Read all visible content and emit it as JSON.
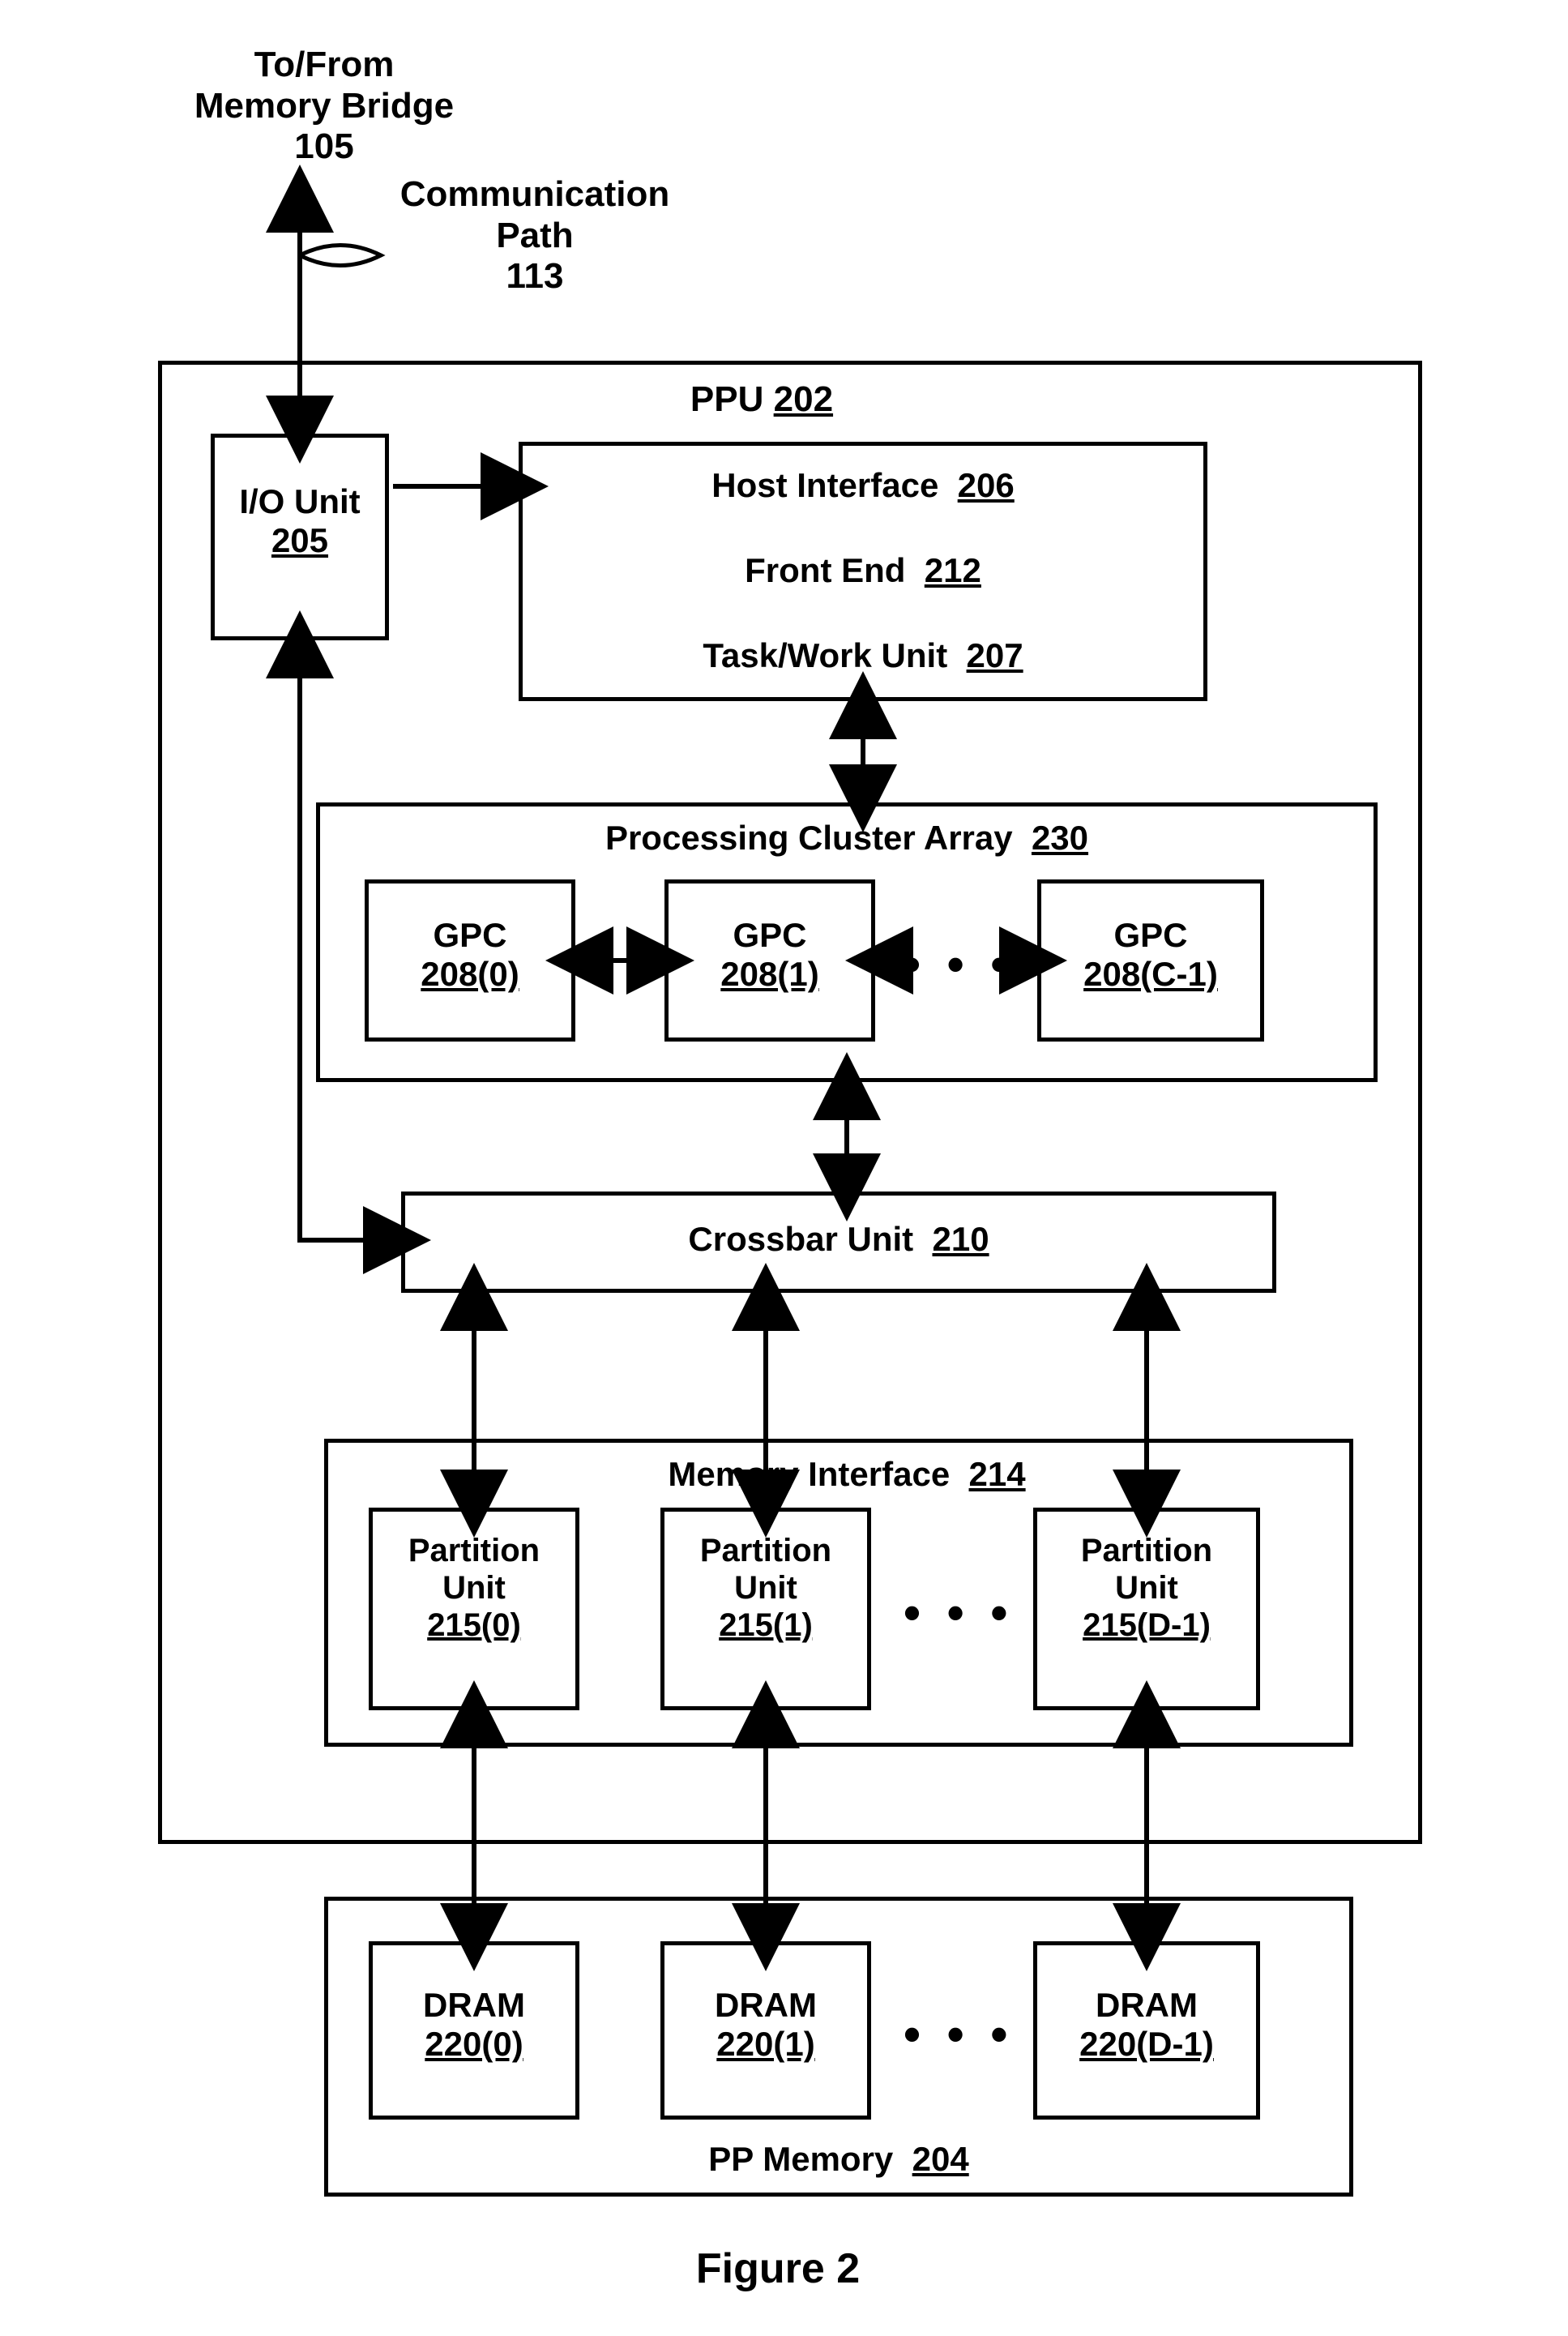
{
  "figure_caption": "Figure 2",
  "top_label": {
    "l1": "To/From",
    "l2": "Memory Bridge",
    "l3": "105"
  },
  "comm_path": {
    "l1": "Communication",
    "l2": "Path",
    "l3": "113"
  },
  "ppu": {
    "name": "PPU",
    "num": "202"
  },
  "io_unit": {
    "name": "I/O Unit",
    "num": "205"
  },
  "host_interface": {
    "name": "Host Interface",
    "num": "206"
  },
  "front_end": {
    "name": "Front End",
    "num": "212"
  },
  "task_work_unit": {
    "name": "Task/Work Unit",
    "num": "207"
  },
  "pca": {
    "name": "Processing Cluster Array",
    "num": "230"
  },
  "gpc0": {
    "name": "GPC",
    "num": "208(0)"
  },
  "gpc1": {
    "name": "GPC",
    "num": "208(1)"
  },
  "gpcN": {
    "name": "GPC",
    "num": "208(C-1)"
  },
  "crossbar": {
    "name": "Crossbar Unit",
    "num": "210"
  },
  "mem_if": {
    "name": "Memory Interface",
    "num": "214"
  },
  "pu0": {
    "name": "Partition",
    "name2": "Unit",
    "num": "215(0)"
  },
  "pu1": {
    "name": "Partition",
    "name2": "Unit",
    "num": "215(1)"
  },
  "puN": {
    "name": "Partition",
    "name2": "Unit",
    "num": "215(D-1)"
  },
  "dram0": {
    "name": "DRAM",
    "num": "220(0)"
  },
  "dram1": {
    "name": "DRAM",
    "num": "220(1)"
  },
  "dramN": {
    "name": "DRAM",
    "num": "220(D-1)"
  },
  "pp_mem": {
    "name": "PP Memory",
    "num": "204"
  },
  "ellipsis": "• • •"
}
